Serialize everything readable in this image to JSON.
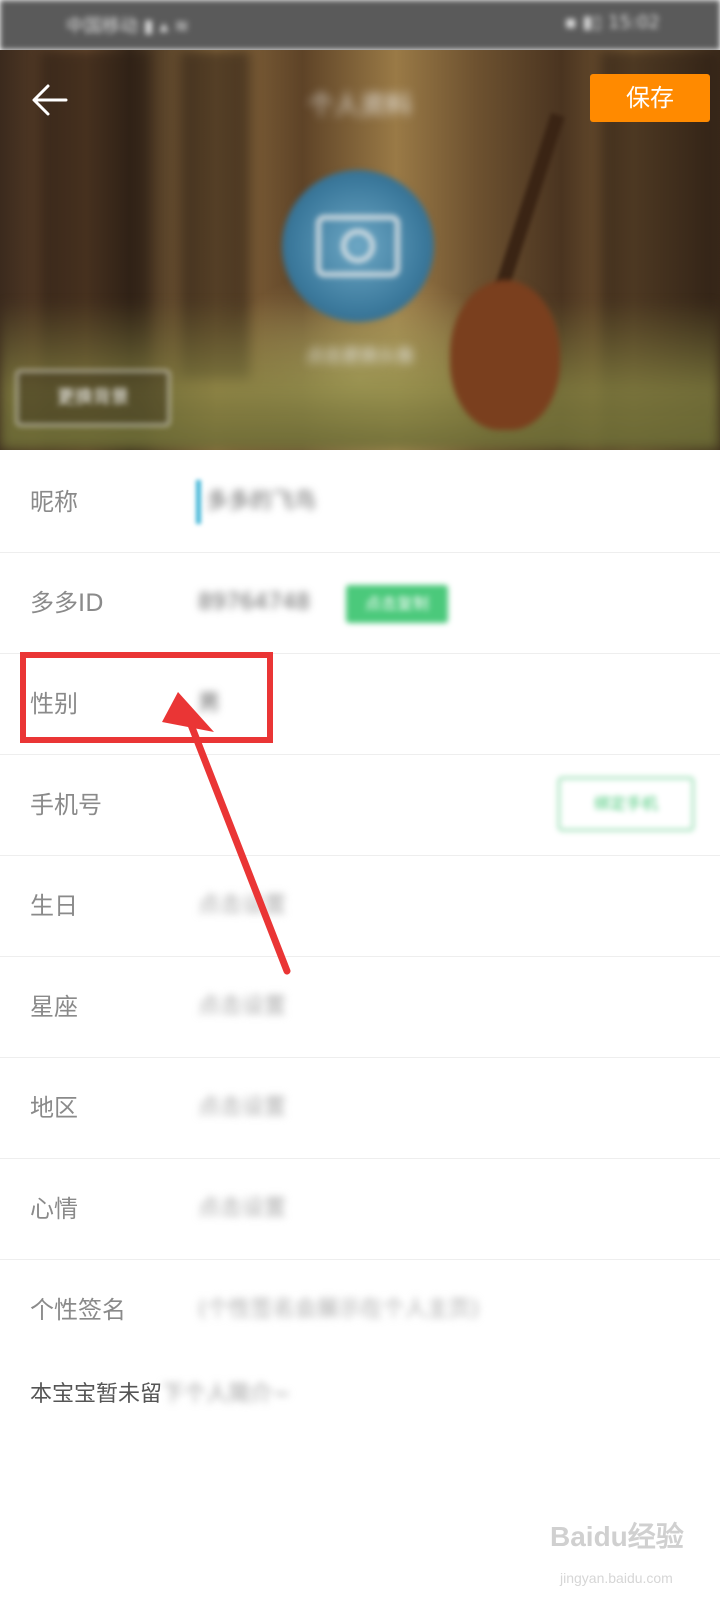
{
  "status_bar": {
    "carrier": "中国移动 ▮ ▴ ≋",
    "right": "▪ ▮▯ 15:02"
  },
  "header": {
    "title": "个人资料",
    "save_label": "保存",
    "avatar_hint": "点击更换头像",
    "change_bg_label": "更换背景"
  },
  "form": {
    "nickname": {
      "label": "昵称",
      "value": "多多的飞鸟"
    },
    "duo_id": {
      "label": "多多ID",
      "value": "89764748",
      "copy_label": "点击复制"
    },
    "gender": {
      "label": "性别",
      "value": "男"
    },
    "phone": {
      "label": "手机号",
      "bind_label": "绑定手机"
    },
    "birthday": {
      "label": "生日",
      "value": "点击设置"
    },
    "zodiac": {
      "label": "星座",
      "value": "点击设置"
    },
    "region": {
      "label": "地区",
      "value": "点击设置"
    },
    "mood": {
      "label": "心情",
      "value": "点击设置"
    },
    "signature": {
      "label": "个性签名",
      "value": "(个性签名会展示在个人主页)"
    }
  },
  "bio": {
    "visible": "本宝宝暂未留",
    "obscured": "下个人简介~"
  },
  "annotation": {
    "highlight_color": "#ea3535"
  },
  "watermark": {
    "logo": "Baidu经验",
    "url": "jingyan.baidu.com"
  },
  "colors": {
    "accent": "#ff8a00",
    "green": "#4bc97b",
    "cursor": "#3fb5d6"
  }
}
